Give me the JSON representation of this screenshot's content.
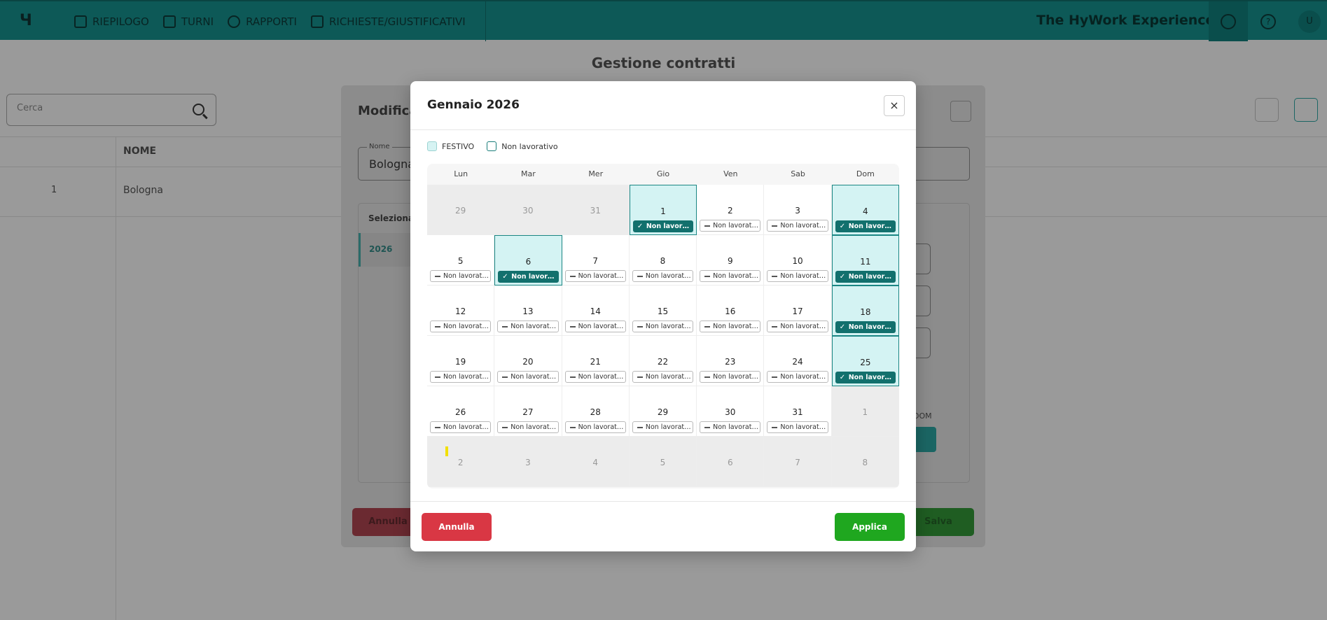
{
  "app": {
    "brand": "The HyWork Experience",
    "nav": [
      {
        "label": "RIEPILOGO",
        "icon": "dashboard-icon"
      },
      {
        "label": "TURNI",
        "icon": "calendar-icon"
      },
      {
        "label": "RAPPORTI",
        "icon": "clock-icon"
      },
      {
        "label": "RICHIESTE/GIUSTIFICATIVI",
        "icon": "checkbox-icon"
      }
    ],
    "user_initial": "U",
    "help_glyph": "?"
  },
  "page": {
    "title": "Gestione contratti",
    "search_placeholder": "Cerca",
    "columns": {
      "name": "NOME"
    },
    "rows": [
      {
        "id": "1",
        "name": "Bologna"
      }
    ]
  },
  "edit_panel": {
    "title": "Modifica",
    "name_label": "Nome",
    "name_value": "Bologna",
    "select_label": "Seleziona",
    "year": "2026",
    "dom_label": "DOM",
    "cancel": "Annulla",
    "save": "Salva"
  },
  "calendar": {
    "title": "Gennaio 2026",
    "close_glyph": "×",
    "legend": {
      "holiday": "FESTIVO",
      "nonworking": "Non lavorativo"
    },
    "weekdays": [
      "Lun",
      "Mar",
      "Mer",
      "Gio",
      "Ven",
      "Sab",
      "Dom"
    ],
    "badge_label": "Non lavorativo",
    "days": [
      {
        "n": "29",
        "out": true
      },
      {
        "n": "30",
        "out": true
      },
      {
        "n": "31",
        "out": true
      },
      {
        "n": "1",
        "badge": true,
        "on": true
      },
      {
        "n": "2",
        "badge": true
      },
      {
        "n": "3",
        "badge": true
      },
      {
        "n": "4",
        "badge": true,
        "on": true
      },
      {
        "n": "5",
        "badge": true
      },
      {
        "n": "6",
        "badge": true,
        "on": true
      },
      {
        "n": "7",
        "badge": true
      },
      {
        "n": "8",
        "badge": true
      },
      {
        "n": "9",
        "badge": true
      },
      {
        "n": "10",
        "badge": true
      },
      {
        "n": "11",
        "badge": true,
        "on": true
      },
      {
        "n": "12",
        "badge": true
      },
      {
        "n": "13",
        "badge": true
      },
      {
        "n": "14",
        "badge": true
      },
      {
        "n": "15",
        "badge": true
      },
      {
        "n": "16",
        "badge": true
      },
      {
        "n": "17",
        "badge": true
      },
      {
        "n": "18",
        "badge": true,
        "on": true
      },
      {
        "n": "19",
        "badge": true
      },
      {
        "n": "20",
        "badge": true
      },
      {
        "n": "21",
        "badge": true
      },
      {
        "n": "22",
        "badge": true
      },
      {
        "n": "23",
        "badge": true
      },
      {
        "n": "24",
        "badge": true
      },
      {
        "n": "25",
        "badge": true,
        "on": true
      },
      {
        "n": "26",
        "badge": true
      },
      {
        "n": "27",
        "badge": true
      },
      {
        "n": "28",
        "badge": true
      },
      {
        "n": "29",
        "badge": true
      },
      {
        "n": "30",
        "badge": true
      },
      {
        "n": "31",
        "badge": true
      },
      {
        "n": "1",
        "out": true
      },
      {
        "n": "2",
        "out": true,
        "mark": true
      },
      {
        "n": "3",
        "out": true
      },
      {
        "n": "4",
        "out": true
      },
      {
        "n": "5",
        "out": true
      },
      {
        "n": "6",
        "out": true
      },
      {
        "n": "7",
        "out": true
      },
      {
        "n": "8",
        "out": true
      }
    ],
    "buttons": {
      "cancel": "Annulla",
      "apply": "Applica"
    }
  },
  "colors": {
    "nav_bg": "#0d5957",
    "selected_cell": "#d4f3f3",
    "selected_badge": "#12706d",
    "cancel": "#d93744",
    "apply": "#1fa71f"
  }
}
